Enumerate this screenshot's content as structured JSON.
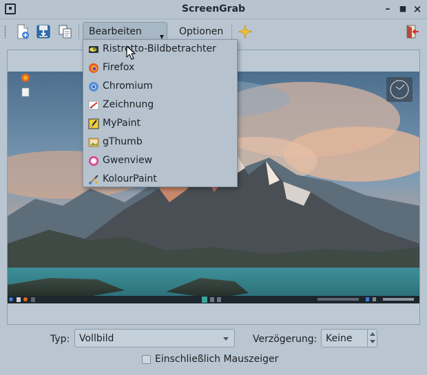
{
  "window": {
    "title": "ScreenGrab",
    "controls": {
      "minimize": "–",
      "maximize": "■",
      "close": "×"
    }
  },
  "toolbar": {
    "new_icon": "new-document-icon",
    "save_icon": "save-icon",
    "copy_icon": "copy-icon",
    "edit_in_label": "Bearbeiten in...",
    "options_label": "Optionen",
    "area_icon": "star-icon",
    "quit_icon": "exit-icon"
  },
  "edit_menu": {
    "items": [
      {
        "label": "Ristretto-Bildbetrachter",
        "icon": "ristretto-icon"
      },
      {
        "label": "Firefox",
        "icon": "firefox-icon"
      },
      {
        "label": "Chromium",
        "icon": "chromium-icon"
      },
      {
        "label": "Zeichnung",
        "icon": "drawing-icon"
      },
      {
        "label": "MyPaint",
        "icon": "mypaint-icon"
      },
      {
        "label": "gThumb",
        "icon": "gthumb-icon"
      },
      {
        "label": "Gwenview",
        "icon": "gwenview-icon"
      },
      {
        "label": "KolourPaint",
        "icon": "kolourpaint-icon"
      }
    ]
  },
  "bottom": {
    "type_label": "Typ:",
    "type_value": "Vollbild",
    "delay_label": "Verzögerung:",
    "delay_value": "Keine",
    "mouse_checkbox_label": "Einschließlich Mauszeiger",
    "mouse_checkbox_checked": false
  },
  "colors": {
    "window_bg": "#b9c6d1",
    "menu_bg": "#b6c3cf",
    "title_text": "#1f2a33"
  }
}
